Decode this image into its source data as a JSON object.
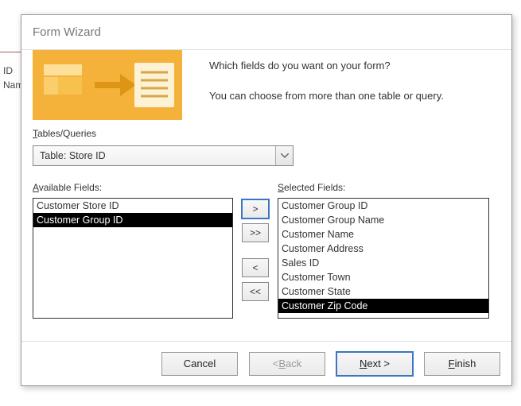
{
  "background": {
    "col1": "ID",
    "col2": "Nam"
  },
  "dialog": {
    "title": "Form Wizard",
    "intro1": "Which fields do you want on your form?",
    "intro2": "You can choose from more than one table or query.",
    "tables_label_pre": "T",
    "tables_label_rest": "ables/Queries",
    "tables_value": "Table: Store ID",
    "available": {
      "label_pre": "A",
      "label_rest": "vailable Fields:",
      "items": [
        {
          "text": "Customer Store ID",
          "selected": false
        },
        {
          "text": "Customer Group ID",
          "selected": true
        }
      ]
    },
    "selected": {
      "label_pre": "S",
      "label_rest": "elected Fields:",
      "items": [
        {
          "text": "Customer Group ID",
          "selected": false
        },
        {
          "text": "Customer Group Name",
          "selected": false
        },
        {
          "text": "Customer Name",
          "selected": false
        },
        {
          "text": "Customer Address",
          "selected": false
        },
        {
          "text": "Sales ID",
          "selected": false
        },
        {
          "text": "Customer Town",
          "selected": false
        },
        {
          "text": "Customer State",
          "selected": false
        },
        {
          "text": "Customer Zip Code",
          "selected": true
        }
      ]
    },
    "move": {
      "add": ">",
      "add_all": ">>",
      "remove": "<",
      "remove_all": "<<"
    },
    "buttons": {
      "cancel": "Cancel",
      "back_pre": "< ",
      "back_u": "B",
      "back_rest": "ack",
      "next_u": "N",
      "next_rest": "ext >",
      "finish_u": "F",
      "finish_rest": "inish"
    }
  }
}
